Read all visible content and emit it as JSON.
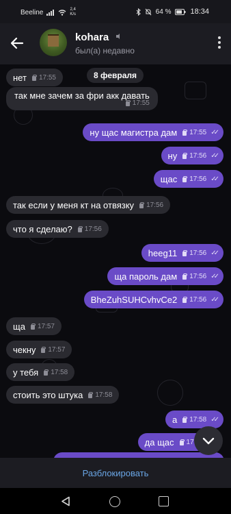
{
  "status_bar": {
    "carrier": "Beeline",
    "speed_value": "2,4",
    "speed_unit": "K/s",
    "battery": "64 %",
    "time": "18:34"
  },
  "header": {
    "title": "kohara",
    "subtitle": "был(а) недавно"
  },
  "date_label": "8 февраля",
  "messages": [
    {
      "text": "нет",
      "time": "17:55",
      "dir": "in"
    },
    {
      "text": "так мне зачем за фри акк давать",
      "time": "17:55",
      "dir": "in"
    },
    {
      "text": "ну щас магистра дам",
      "time": "17:55",
      "dir": "out"
    },
    {
      "text": "ну",
      "time": "17:56",
      "dir": "out"
    },
    {
      "text": "щас",
      "time": "17:56",
      "dir": "out"
    },
    {
      "text": "так если у меня кт на отвязку",
      "time": "17:56",
      "dir": "in"
    },
    {
      "text": "что я сделаю?",
      "time": "17:56",
      "dir": "in"
    },
    {
      "text": "heeg11",
      "time": "17:56",
      "dir": "out"
    },
    {
      "text": "ща пароль дам",
      "time": "17:56",
      "dir": "out"
    },
    {
      "text": "BheZuhSUHCvhvCe2",
      "time": "17:56",
      "dir": "out"
    },
    {
      "text": "ща",
      "time": "17:57",
      "dir": "in"
    },
    {
      "text": "чекну",
      "time": "17:57",
      "dir": "in"
    },
    {
      "text": "у тебя",
      "time": "17:58",
      "dir": "in"
    },
    {
      "text": "стоить это штука",
      "time": "17:58",
      "dir": "in"
    },
    {
      "text": "а",
      "time": "17:58",
      "dir": "out"
    },
    {
      "text": "да щас",
      "time": "17:5",
      "dir": "out"
    }
  ],
  "bottom": {
    "unblock_label": "Разблокировать"
  },
  "colors": {
    "outgoing_bubble": "#6a4bc7",
    "incoming_bubble": "#2a2a30",
    "accent_link": "#6aa6e6"
  }
}
